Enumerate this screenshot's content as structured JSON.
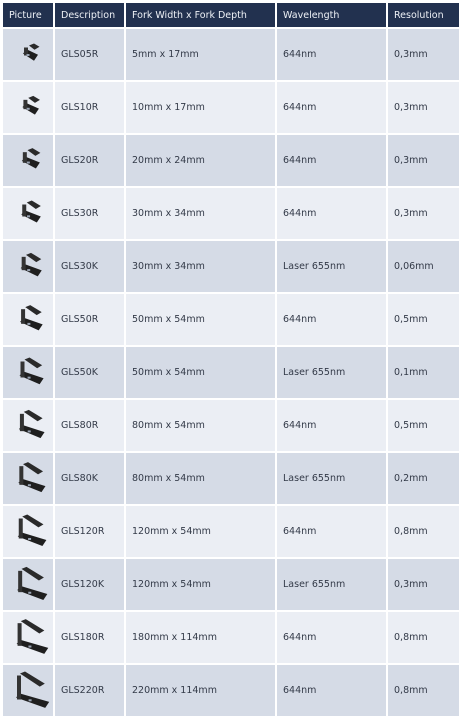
{
  "table": {
    "headers": [
      "Picture",
      "Description",
      "Fork Width x Fork Depth",
      "Wavelength",
      "Resolution"
    ],
    "rows": [
      {
        "icon": "fork-sensor-icon",
        "description": "GLS05R",
        "fork": "5mm x 17mm",
        "wavelength": "644nm",
        "resolution": "0,3mm"
      },
      {
        "icon": "fork-sensor-icon",
        "description": "GLS10R",
        "fork": "10mm x 17mm",
        "wavelength": "644nm",
        "resolution": "0,3mm"
      },
      {
        "icon": "fork-sensor-icon",
        "description": "GLS20R",
        "fork": "20mm x 24mm",
        "wavelength": "644nm",
        "resolution": "0,3mm"
      },
      {
        "icon": "fork-sensor-icon",
        "description": "GLS30R",
        "fork": "30mm x 34mm",
        "wavelength": "644nm",
        "resolution": "0,3mm"
      },
      {
        "icon": "fork-sensor-icon",
        "description": "GLS30K",
        "fork": "30mm x 34mm",
        "wavelength": "Laser 655nm",
        "resolution": "0,06mm"
      },
      {
        "icon": "fork-sensor-icon",
        "description": "GLS50R",
        "fork": "50mm x 54mm",
        "wavelength": "644nm",
        "resolution": "0,5mm"
      },
      {
        "icon": "fork-sensor-icon",
        "description": "GLS50K",
        "fork": "50mm x 54mm",
        "wavelength": "Laser 655nm",
        "resolution": "0,1mm"
      },
      {
        "icon": "fork-sensor-icon",
        "description": "GLS80R",
        "fork": "80mm x 54mm",
        "wavelength": "644nm",
        "resolution": "0,5mm"
      },
      {
        "icon": "fork-sensor-icon",
        "description": "GLS80K",
        "fork": "80mm x 54mm",
        "wavelength": "Laser 655nm",
        "resolution": "0,2mm"
      },
      {
        "icon": "fork-sensor-icon",
        "description": "GLS120R",
        "fork": "120mm x 54mm",
        "wavelength": "644nm",
        "resolution": "0,8mm"
      },
      {
        "icon": "fork-sensor-icon",
        "description": "GLS120K",
        "fork": "120mm x 54mm",
        "wavelength": "Laser 655nm",
        "resolution": "0,3mm"
      },
      {
        "icon": "fork-sensor-icon",
        "description": "GLS180R",
        "fork": "180mm x 114mm",
        "wavelength": "644nm",
        "resolution": "0,8mm"
      },
      {
        "icon": "fork-sensor-icon",
        "description": "GLS220R",
        "fork": "220mm x 114mm",
        "wavelength": "644nm",
        "resolution": "0,8mm"
      }
    ]
  },
  "colors": {
    "header_bg": "#22314f",
    "header_text": "#eef1f6",
    "row_dark": "#d5dbe6",
    "row_light": "#ebeef4",
    "cell_text": "#333a48"
  }
}
